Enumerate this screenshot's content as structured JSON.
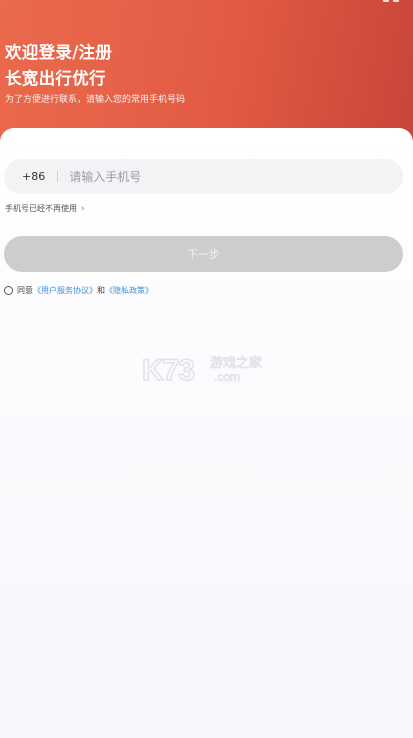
{
  "header": {
    "title_line1": "欢迎登录/注册",
    "title_line2": "长宽出行优行",
    "subtitle": "为了方便进行联系，请输入您的常用手机号码"
  },
  "form": {
    "country_code": "+86",
    "phone_placeholder": "请输入手机号",
    "no_longer_used": "手机号已经不再使用",
    "next_label": "下一步"
  },
  "agreement": {
    "prefix": "同意",
    "user_agreement": "《用户服务协议》",
    "and": "和",
    "privacy_policy": "《隐私政策》"
  },
  "watermark": {
    "brand": "K73",
    "site_cn": "游戏之家",
    "domain": ".com"
  },
  "colors": {
    "header_start": "#ea6a4d",
    "header_end": "#c8453a",
    "button_disabled": "#cdcdcf",
    "link": "#3f8fd8"
  }
}
